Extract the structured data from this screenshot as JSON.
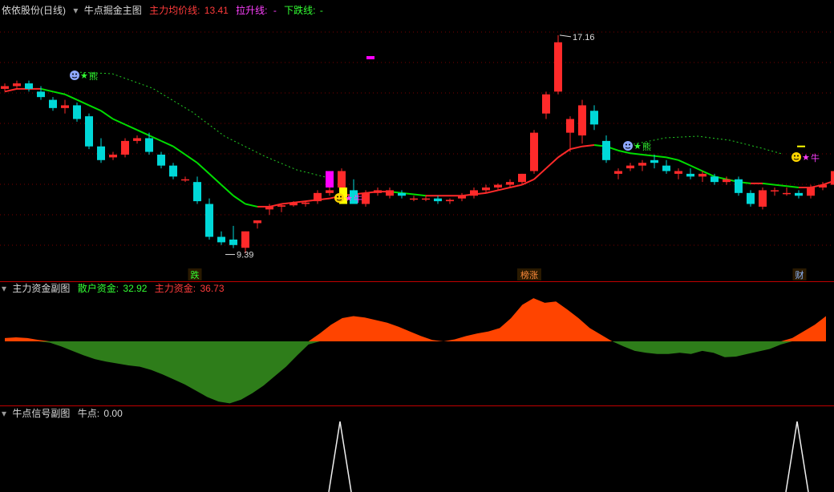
{
  "main_panel": {
    "stock_name": "依依股份(日线)",
    "indicator_name": "牛点掘金主图",
    "avg_line_label": "主力均价线:",
    "avg_line_value": "13.41",
    "up_line_label": "拉升线:",
    "up_line_value": "-",
    "down_line_label": "下跌线:",
    "down_line_value": "-",
    "high_marker": "17.16",
    "low_marker": "9.39",
    "badges": [
      {
        "text": "跌",
        "color": "#33ff33"
      },
      {
        "text": "榜涨",
        "color": "#ff8c3b"
      },
      {
        "text": "财",
        "color": "#8fb8ff"
      }
    ],
    "signal_labels": [
      "熊",
      "牛",
      "熊",
      "牛"
    ]
  },
  "fund_panel": {
    "name": "主力资金副图",
    "retail_label": "散户资金:",
    "retail_value": "32.92",
    "main_label": "主力资金:",
    "main_value": "36.73"
  },
  "signal_panel": {
    "name": "牛点信号副图",
    "value_label": "牛点:",
    "value": "0.00"
  },
  "colors": {
    "up": "#ff2a2a",
    "down": "#00d8d8",
    "ma": "#00dd00",
    "positive_fund": "#ff4400",
    "negative_fund": "#2e7d1a"
  },
  "chart_data": [
    {
      "type": "candlestick",
      "title": "牛点掘金主图",
      "ylim": [
        8.5,
        17.8
      ],
      "ohlc": [
        [
          15.2,
          15.4,
          15.1,
          15.3
        ],
        [
          15.3,
          15.5,
          15.2,
          15.4
        ],
        [
          15.4,
          15.5,
          15.1,
          15.2
        ],
        [
          15.1,
          15.3,
          14.8,
          14.9
        ],
        [
          14.8,
          14.9,
          14.4,
          14.5
        ],
        [
          14.5,
          14.8,
          14.3,
          14.6
        ],
        [
          14.6,
          14.7,
          14.0,
          14.1
        ],
        [
          14.2,
          14.3,
          13.0,
          13.1
        ],
        [
          13.1,
          13.4,
          12.5,
          12.6
        ],
        [
          12.7,
          12.9,
          12.6,
          12.8
        ],
        [
          12.8,
          13.4,
          12.7,
          13.3
        ],
        [
          13.3,
          13.5,
          13.2,
          13.4
        ],
        [
          13.4,
          13.6,
          12.8,
          12.9
        ],
        [
          12.8,
          12.9,
          12.3,
          12.4
        ],
        [
          12.4,
          12.5,
          11.9,
          12.0
        ],
        [
          11.9,
          12.0,
          11.8,
          11.9
        ],
        [
          11.8,
          12.0,
          11.0,
          11.1
        ],
        [
          11.0,
          11.2,
          9.7,
          9.8
        ],
        [
          9.8,
          10.0,
          9.5,
          9.6
        ],
        [
          9.7,
          10.2,
          9.39,
          9.5
        ],
        [
          9.4,
          10.0,
          9.2,
          10.0
        ],
        [
          10.3,
          10.4,
          10.1,
          10.4
        ],
        [
          10.8,
          11.0,
          10.6,
          10.9
        ],
        [
          10.9,
          11.0,
          10.7,
          10.95
        ],
        [
          10.95,
          11.1,
          10.9,
          11.05
        ],
        [
          11.0,
          11.1,
          10.9,
          11.05
        ],
        [
          11.1,
          11.5,
          11.0,
          11.4
        ],
        [
          11.4,
          11.6,
          11.3,
          11.5
        ],
        [
          11.6,
          12.3,
          11.5,
          12.2
        ],
        [
          11.5,
          11.9,
          11.0,
          11.0
        ],
        [
          11.0,
          11.5,
          10.9,
          11.4
        ],
        [
          11.4,
          11.6,
          11.3,
          11.5
        ],
        [
          11.3,
          11.6,
          11.2,
          11.5
        ],
        [
          11.4,
          11.5,
          11.2,
          11.3
        ],
        [
          11.2,
          11.3,
          11.1,
          11.2
        ],
        [
          11.2,
          11.3,
          11.1,
          11.2
        ],
        [
          11.2,
          11.3,
          11.0,
          11.1
        ],
        [
          11.1,
          11.2,
          11.0,
          11.15
        ],
        [
          11.2,
          11.4,
          11.1,
          11.3
        ],
        [
          11.3,
          11.6,
          11.2,
          11.5
        ],
        [
          11.5,
          11.7,
          11.4,
          11.6
        ],
        [
          11.6,
          11.75,
          11.5,
          11.7
        ],
        [
          11.7,
          11.9,
          11.6,
          11.8
        ],
        [
          11.8,
          12.1,
          11.7,
          12.1
        ],
        [
          12.2,
          13.7,
          12.1,
          13.6
        ],
        [
          14.3,
          15.1,
          14.1,
          15.0
        ],
        [
          15.1,
          17.16,
          15.0,
          16.9
        ],
        [
          13.6,
          14.2,
          12.9,
          14.1
        ],
        [
          13.5,
          14.8,
          13.2,
          14.6
        ],
        [
          14.4,
          14.6,
          13.7,
          13.9
        ],
        [
          13.3,
          13.5,
          12.5,
          12.6
        ],
        [
          12.1,
          12.3,
          11.9,
          12.2
        ],
        [
          12.3,
          12.5,
          12.2,
          12.4
        ],
        [
          12.4,
          12.6,
          12.2,
          12.5
        ],
        [
          12.6,
          12.8,
          12.3,
          12.5
        ],
        [
          12.4,
          12.6,
          12.1,
          12.2
        ],
        [
          12.1,
          12.3,
          11.9,
          12.2
        ],
        [
          12.1,
          12.3,
          11.9,
          12.0
        ],
        [
          12.0,
          12.2,
          11.8,
          12.1
        ],
        [
          12.0,
          12.1,
          11.7,
          11.8
        ],
        [
          11.8,
          12.0,
          11.7,
          11.9
        ],
        [
          11.9,
          12.0,
          11.3,
          11.4
        ],
        [
          11.4,
          11.5,
          10.9,
          11.0
        ],
        [
          10.9,
          11.6,
          10.8,
          11.5
        ],
        [
          11.5,
          11.6,
          11.3,
          11.5
        ],
        [
          11.4,
          11.6,
          11.3,
          11.4
        ],
        [
          11.4,
          11.5,
          11.2,
          11.3
        ],
        [
          11.3,
          11.7,
          11.2,
          11.6
        ],
        [
          11.6,
          11.8,
          11.5,
          11.7
        ],
        [
          11.7,
          12.3,
          11.6,
          12.2
        ],
        [
          12.5,
          13.0,
          12.4,
          12.9
        ],
        [
          12.8,
          13.1,
          12.6,
          12.9
        ],
        [
          12.9,
          13.3,
          12.8,
          13.2
        ],
        [
          13.2,
          13.7,
          13.1,
          13.5
        ]
      ],
      "ma_line": [
        15.1,
        15.2,
        15.2,
        15.2,
        15.1,
        15.0,
        14.8,
        14.6,
        14.4,
        14.1,
        13.9,
        13.7,
        13.5,
        13.3,
        13.1,
        12.8,
        12.5,
        12.1,
        11.7,
        11.3,
        11.0,
        10.9,
        10.9,
        11.0,
        11.05,
        11.1,
        11.15,
        11.2,
        11.3,
        11.35,
        11.4,
        11.45,
        11.45,
        11.4,
        11.35,
        11.3,
        11.3,
        11.3,
        11.3,
        11.35,
        11.4,
        11.5,
        11.6,
        11.7,
        11.9,
        12.3,
        12.7,
        13.0,
        13.1,
        13.15,
        13.1,
        12.95,
        12.85,
        12.8,
        12.75,
        12.7,
        12.6,
        12.4,
        12.2,
        12.0,
        11.9,
        11.8,
        11.75,
        11.75,
        11.7,
        11.65,
        11.6,
        11.6,
        11.7,
        11.85,
        12.0,
        12.1,
        12.2,
        12.3
      ],
      "series": [
        {
          "name": "主力均价线",
          "color": "#ff2a2a"
        },
        {
          "name": "拉升线",
          "color": "#ff40ff"
        },
        {
          "name": "下跌线",
          "color": "#33ff33"
        }
      ]
    },
    {
      "type": "area",
      "title": "主力资金副图",
      "ylim": [
        -100,
        70
      ],
      "values": [
        5,
        6,
        5,
        2,
        -2,
        -8,
        -15,
        -22,
        -28,
        -32,
        -35,
        -38,
        -40,
        -45,
        -52,
        -60,
        -68,
        -78,
        -88,
        -95,
        -98,
        -92,
        -82,
        -70,
        -55,
        -40,
        -22,
        -5,
        12,
        25,
        35,
        38,
        36,
        32,
        28,
        22,
        15,
        8,
        2,
        0,
        3,
        8,
        12,
        15,
        20,
        35,
        55,
        65,
        58,
        60,
        48,
        35,
        20,
        10,
        0,
        -8,
        -15,
        -18,
        -20,
        -20,
        -18,
        -20,
        -15,
        -18,
        -25,
        -24,
        -20,
        -16,
        -12,
        -5,
        5,
        15,
        25,
        38
      ],
      "series": [
        {
          "name": "散户资金",
          "value": 32.92
        },
        {
          "name": "主力资金",
          "value": 36.73
        }
      ]
    },
    {
      "type": "line",
      "title": "牛点信号副图",
      "ylim": [
        0,
        1
      ],
      "spikes_at_candle": [
        28,
        66
      ],
      "series": [
        {
          "name": "牛点",
          "value": 0.0
        }
      ]
    }
  ]
}
